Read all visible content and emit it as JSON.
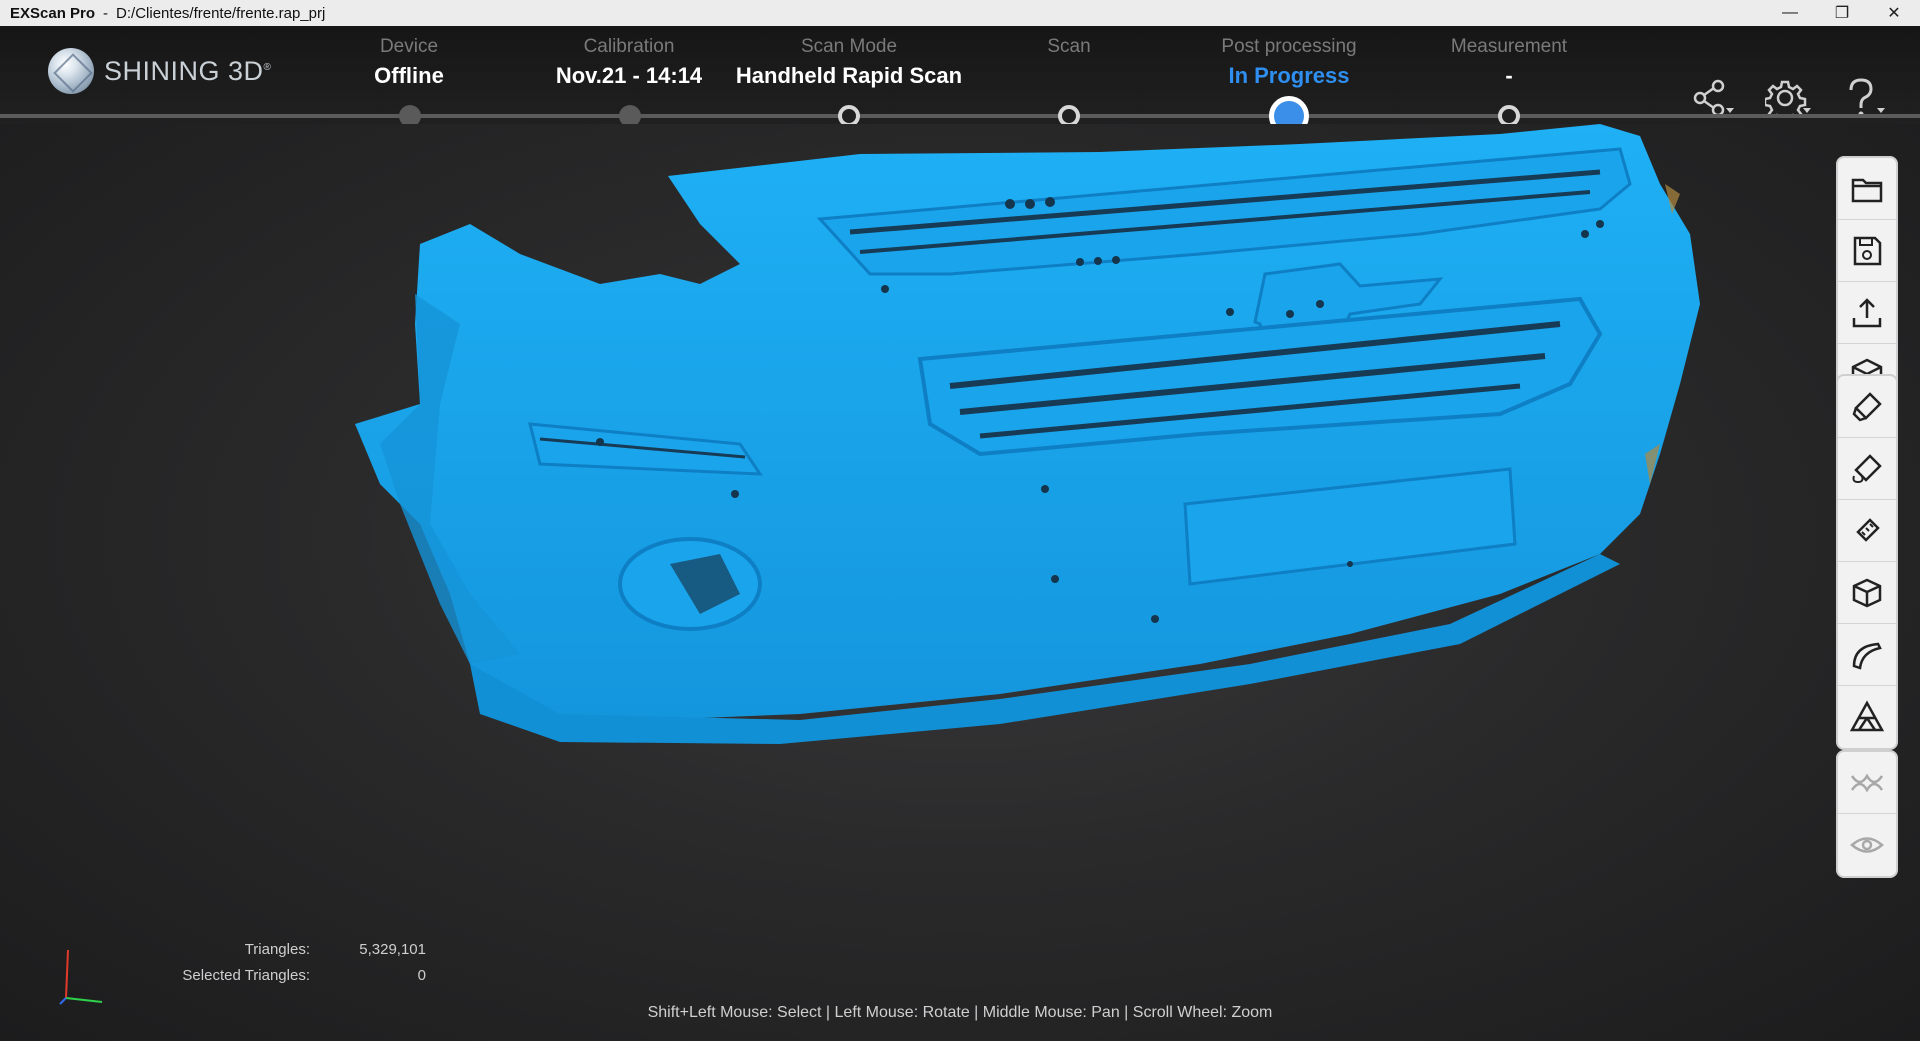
{
  "window": {
    "app_name": "EXScan Pro",
    "separator": "-",
    "project_path": "D:/Clientes/frente/frente.rap_prj",
    "minimize": "—",
    "restore": "❐",
    "close": "✕"
  },
  "brand": {
    "name": "SHINING 3D",
    "mark": "®"
  },
  "steps": [
    {
      "label": "Device",
      "value": "Offline",
      "state": "done"
    },
    {
      "label": "Calibration",
      "value": "Nov.21 - 14:14",
      "state": "done"
    },
    {
      "label": "Scan Mode",
      "value": "Handheld Rapid Scan",
      "state": "ring"
    },
    {
      "label": "Scan",
      "value": "",
      "state": "ring"
    },
    {
      "label": "Post processing",
      "value": "In Progress",
      "state": "current"
    },
    {
      "label": "Measurement",
      "value": "-",
      "state": "ring"
    }
  ],
  "header_icons": [
    "share-icon",
    "settings-icon",
    "help-icon"
  ],
  "toolbar": {
    "file_tools": [
      "open-folder-icon",
      "save-icon",
      "export-icon",
      "model-cube-icon"
    ],
    "edit_tools": [
      "erase-icon",
      "fill-icon",
      "marker-icon",
      "box-icon",
      "curve-icon",
      "mesh-triangle-icon"
    ],
    "view_tools": [
      "wave-icon",
      "visibility-eye-icon"
    ]
  },
  "stats": {
    "triangles_label": "Triangles:",
    "triangles_value": "5,329,101",
    "selected_label": "Selected Triangles:",
    "selected_value": "0"
  },
  "hint": "Shift+Left Mouse: Select | Left Mouse: Rotate | Middle Mouse: Pan | Scroll Wheel: Zoom",
  "colors": {
    "accent": "#3b8fe8",
    "model_blue": "#1ea8f0",
    "background": "#2a2a2b"
  }
}
